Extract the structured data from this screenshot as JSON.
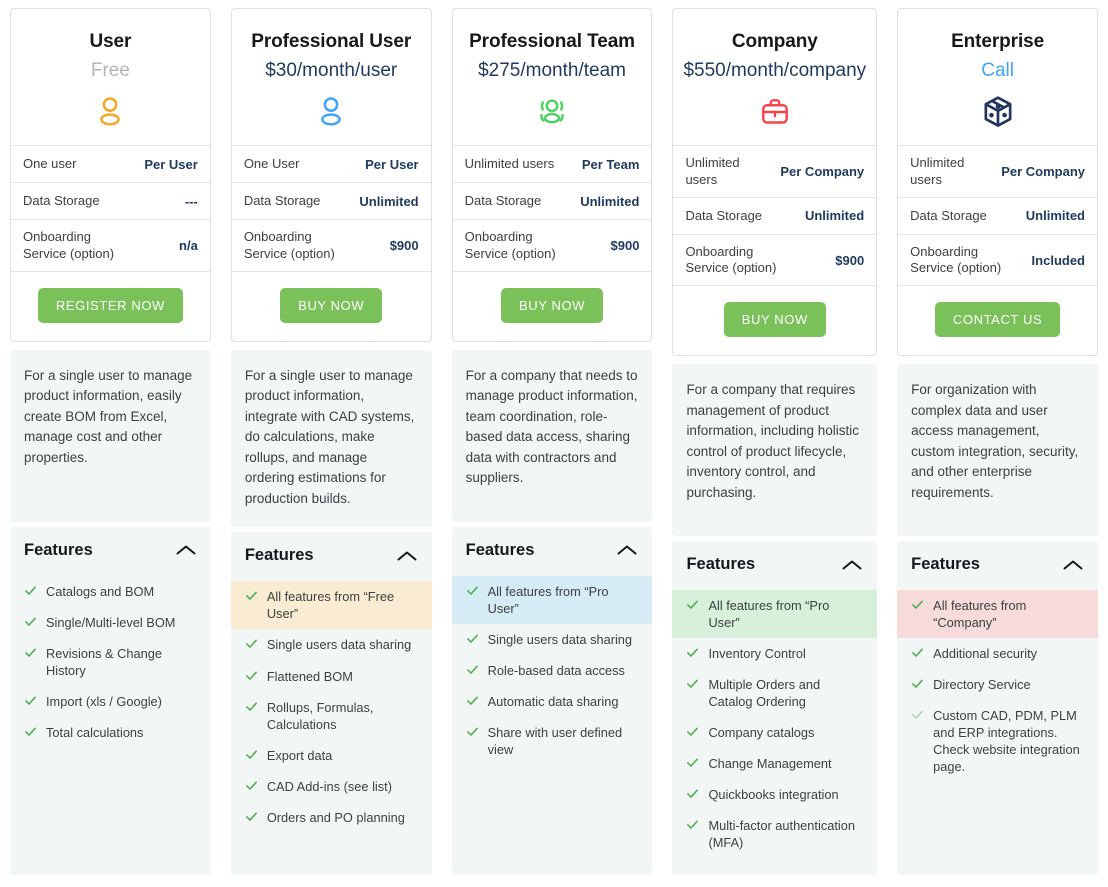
{
  "theme": {
    "cta_green": "#7bc159",
    "value_navy": "#1e3a5f",
    "tick_green": "#4caf50",
    "panel_bg": "#f2f7f6",
    "card_border": "#dcdfe3"
  },
  "plans": [
    {
      "name": "User",
      "price": "Free",
      "price_color": "#b5b5b5",
      "icon": "single-user-icon",
      "icon_color": "#f5a623",
      "specs": [
        {
          "label": "One user",
          "value": "Per User"
        },
        {
          "label": "Data Storage",
          "value": "---"
        },
        {
          "label": "Onboarding\nService (option)",
          "value": "n/a"
        }
      ],
      "cta": "REGISTER NOW",
      "description": "For a single user to manage product information, easily create BOM from Excel, manage cost and other properties.",
      "features_title": "Features",
      "features": [
        {
          "text": "Catalogs and BOM",
          "highlight": ""
        },
        {
          "text": "Single/Multi-level BOM",
          "highlight": ""
        },
        {
          "text": "Revisions & Change History",
          "highlight": ""
        },
        {
          "text": "Import (xls / Google)",
          "highlight": ""
        },
        {
          "text": "Total calculations",
          "highlight": ""
        }
      ]
    },
    {
      "name": "Professional User",
      "price": "$30/month/user",
      "price_color": "#1e3a5f",
      "icon": "single-user-icon",
      "icon_color": "#41a5f5",
      "specs": [
        {
          "label": "One User",
          "value": "Per User"
        },
        {
          "label": "Data Storage",
          "value": "Unlimited"
        },
        {
          "label": "Onboarding\nService (option)",
          "value": "$900"
        }
      ],
      "cta": "BUY NOW",
      "description": "For a single user to manage product information, integrate with CAD systems, do calculations, make rollups, and manage ordering estimations for production builds.",
      "features_title": "Features",
      "features": [
        {
          "text": "All features from “Free User”",
          "highlight": "yellow"
        },
        {
          "text": "Single users data sharing",
          "highlight": ""
        },
        {
          "text": "Flattened BOM",
          "highlight": ""
        },
        {
          "text": "Rollups, Formulas, Calculations",
          "highlight": ""
        },
        {
          "text": "Export data",
          "highlight": ""
        },
        {
          "text": "CAD Add-ins (see list)",
          "highlight": ""
        },
        {
          "text": "Orders and PO planning",
          "highlight": ""
        }
      ]
    },
    {
      "name": "Professional Team",
      "price": "$275/month/team",
      "price_color": "#1e3a5f",
      "icon": "team-users-icon",
      "icon_color": "#4ad45e",
      "specs": [
        {
          "label": "Unlimited users",
          "value": "Per Team"
        },
        {
          "label": "Data Storage",
          "value": "Unlimited"
        },
        {
          "label": "Onboarding\nService (option)",
          "value": "$900"
        }
      ],
      "cta": "BUY NOW",
      "description": "For a company that needs to manage product information, team coordination, role-based data access, sharing data with contractors and suppliers.",
      "features_title": "Features",
      "features": [
        {
          "text": "All features from “Pro User”",
          "highlight": "blue"
        },
        {
          "text": "Single users data sharing",
          "highlight": ""
        },
        {
          "text": "Role-based data access",
          "highlight": ""
        },
        {
          "text": "Automatic data sharing",
          "highlight": ""
        },
        {
          "text": "Share with user defined view",
          "highlight": ""
        }
      ]
    },
    {
      "name": "Company",
      "price": "$550/month/company",
      "price_color": "#1e3a5f",
      "icon": "briefcase-icon",
      "icon_color": "#f5454a",
      "specs": [
        {
          "label": "Unlimited users",
          "value": "Per Company"
        },
        {
          "label": "Data Storage",
          "value": "Unlimited"
        },
        {
          "label": "Onboarding\nService (option)",
          "value": "$900"
        }
      ],
      "cta": "BUY NOW",
      "description": "For a company that requires management of product information, including holistic control of product lifecycle, inventory control, and purchasing.",
      "features_title": "Features",
      "features": [
        {
          "text": "All features from “Pro User”",
          "highlight": "green"
        },
        {
          "text": "Inventory Control",
          "highlight": ""
        },
        {
          "text": "Multiple Orders and Catalog Ordering",
          "highlight": ""
        },
        {
          "text": "Company catalogs",
          "highlight": ""
        },
        {
          "text": "Change Management",
          "highlight": ""
        },
        {
          "text": "Quickbooks integration",
          "highlight": ""
        },
        {
          "text": "Multi-factor authentication (MFA)",
          "highlight": ""
        }
      ]
    },
    {
      "name": "Enterprise",
      "price": "Call",
      "price_color": "#41a5f5",
      "icon": "cube-box-icon",
      "icon_color": "#22365c",
      "specs": [
        {
          "label": "Unlimited users",
          "value": "Per Company"
        },
        {
          "label": "Data Storage",
          "value": "Unlimited"
        },
        {
          "label": "Onboarding\nService (option)",
          "value": "Included"
        }
      ],
      "cta": "CONTACT US",
      "description": "For organization with complex data and user access management, custom integration, security, and other enterprise requirements.",
      "features_title": "Features",
      "features": [
        {
          "text": "All features from “Company”",
          "highlight": "pink"
        },
        {
          "text": "Additional security",
          "highlight": ""
        },
        {
          "text": "Directory Service",
          "highlight": ""
        },
        {
          "text": "Custom CAD, PDM, PLM and ERP integrations. Check website integration page.",
          "highlight": ""
        }
      ]
    }
  ]
}
